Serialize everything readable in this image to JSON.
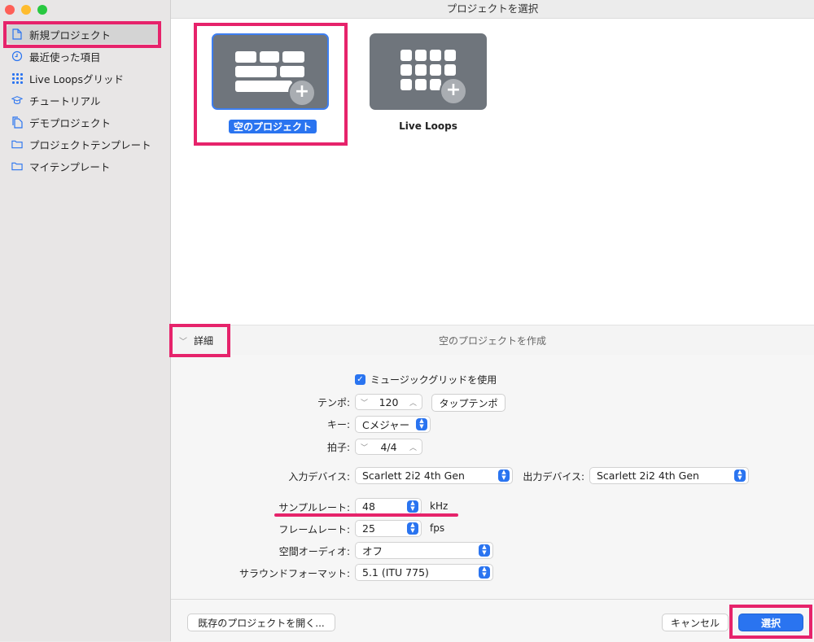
{
  "window": {
    "title": "プロジェクトを選択"
  },
  "sidebar": {
    "items": [
      {
        "label": "新規プロジェクト",
        "icon": "document-icon"
      },
      {
        "label": "最近使った項目",
        "icon": "clock-icon"
      },
      {
        "label": "Live Loopsグリッド",
        "icon": "grid-icon"
      },
      {
        "label": "チュートリアル",
        "icon": "graduation-cap-icon"
      },
      {
        "label": "デモプロジェクト",
        "icon": "documents-icon"
      },
      {
        "label": "プロジェクトテンプレート",
        "icon": "folder-icon"
      },
      {
        "label": "マイテンプレート",
        "icon": "folder-icon"
      }
    ]
  },
  "templates": [
    {
      "label": "空のプロジェクト",
      "selected": true
    },
    {
      "label": "Live Loops",
      "selected": false
    }
  ],
  "details": {
    "toggle_label": "詳細",
    "caption": "空のプロジェクトを作成"
  },
  "form": {
    "music_grid_label": "ミュージックグリッドを使用",
    "music_grid_checked": true,
    "tempo_label": "テンポ:",
    "tempo_value": "120",
    "tap_tempo_label": "タップテンポ",
    "key_label": "キー:",
    "key_value": "Cメジャー",
    "time_sig_label": "拍子:",
    "time_sig_value": "4/4",
    "input_label": "入力デバイス:",
    "input_value": "Scarlett 2i2 4th Gen",
    "output_label": "出力デバイス:",
    "output_value": "Scarlett 2i2 4th Gen",
    "sample_rate_label": "サンプルレート:",
    "sample_rate_value": "48",
    "sample_rate_unit": "kHz",
    "frame_rate_label": "フレームレート:",
    "frame_rate_value": "25",
    "frame_rate_unit": "fps",
    "spatial_label": "空間オーディオ:",
    "spatial_value": "オフ",
    "surround_label": "サラウンドフォーマット:",
    "surround_value": "5.1 (ITU 775)"
  },
  "footer": {
    "open_existing_label": "既存のプロジェクトを開く...",
    "cancel_label": "キャンセル",
    "choose_label": "選択"
  },
  "colors": {
    "accent": "#2a74f0",
    "highlight": "#e6236b",
    "tile": "#6f757c"
  }
}
